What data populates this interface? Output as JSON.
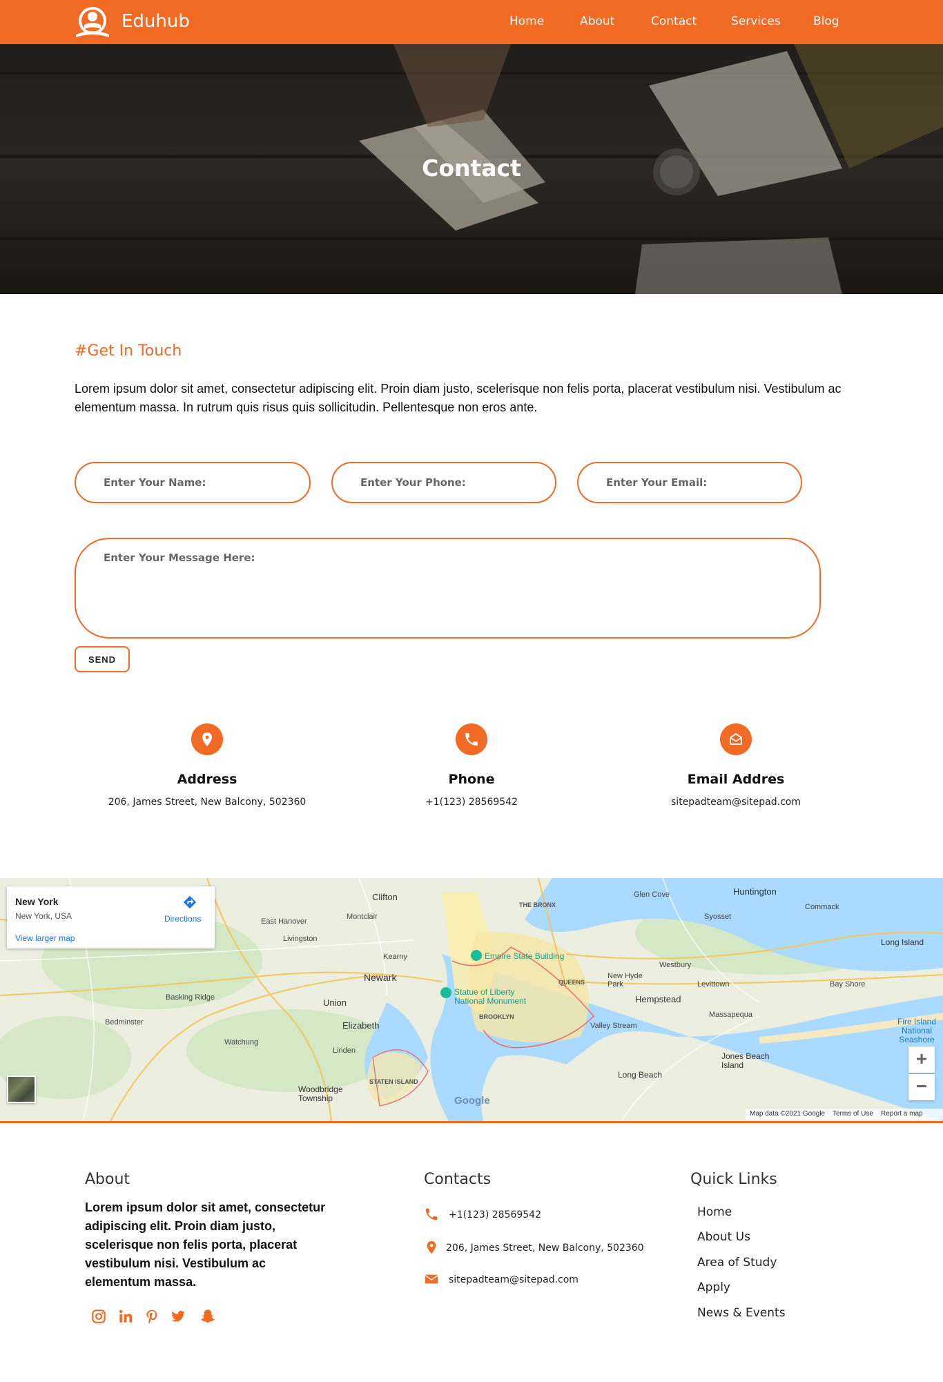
{
  "header": {
    "brand": "Eduhub",
    "nav": [
      "Home",
      "About",
      "Contact",
      "Services",
      "Blog"
    ]
  },
  "hero": {
    "title": "Contact"
  },
  "get_in_touch": {
    "tag": "#Get In Touch",
    "intro": "Lorem ipsum dolor sit amet, consectetur adipiscing elit. Proin diam justo, scelerisque non felis porta, placerat vestibulum nisi. Vestibulum ac elementum massa. In rutrum quis risus quis sollicitudin. Pellentesque non eros ante."
  },
  "form": {
    "name_placeholder": "Enter Your Name:",
    "phone_placeholder": "Enter Your Phone:",
    "email_placeholder": "Enter Your Email:",
    "message_placeholder": "Enter Your Message Here:",
    "send_label": "SEND"
  },
  "contact_info": [
    {
      "icon": "location-pin-icon",
      "title": "Address",
      "text": "206, James Street, New Balcony, 502360"
    },
    {
      "icon": "phone-icon",
      "title": "Phone",
      "text": "+1(123) 28569542"
    },
    {
      "icon": "envelope-open-icon",
      "title": "Email Addres",
      "text": "sitepadteam@sitepad.com"
    }
  ],
  "map": {
    "place_name": "New York",
    "place_sub": "New York, USA",
    "view_larger": "View larger map",
    "directions": "Directions",
    "attribution": "Map data ©2021 Google",
    "terms": "Terms of Use",
    "report": "Report a map error",
    "google": "Google",
    "labels": {
      "clifton": "Clifton",
      "newark": "Newark",
      "union": "Union",
      "elizabeth": "Elizabeth",
      "queens": "QUEENS",
      "brooklyn": "BROOKLYN",
      "the_bronx": "THE BRONX",
      "empire": "Empire State Building",
      "liberty": "Statue of Liberty National Monument",
      "hempstead": "Hempstead",
      "huntington": "Huntington",
      "long_beach": "Long Beach",
      "levittown": "Levittown",
      "glen_cove": "Glen Cove",
      "montclair": "Montclair",
      "kearny": "Kearny",
      "linden": "Linden",
      "bedminster": "Bedminster",
      "staten_island": "STATEN ISLAND",
      "jones_beach": "Jones Beach Island",
      "fire_island": "Fire Island National Seashore",
      "long_island": "Long Island",
      "massapequa": "Massapequa",
      "valley_stream": "Valley Stream",
      "woodbridge": "Woodbridge Township",
      "basking_ridge": "Basking Ridge",
      "livingston": "Livingston",
      "east_hanover": "East Hanover",
      "watchung": "Watchung",
      "new_hyde_park": "New Hyde Park",
      "westbury": "Westbury",
      "syosset": "Syosset",
      "commack": "Commack",
      "bay_shore": "Bay Shore"
    }
  },
  "footer": {
    "about_head": "About",
    "about_text": "Lorem ipsum dolor sit amet, consectetur adipiscing elit. Proin diam justo, scelerisque non felis porta, placerat vestibulum nisi. Vestibulum ac elementum massa.",
    "contacts_head": "Contacts",
    "contacts": [
      {
        "icon": "phone-icon",
        "text": "+1(123) 28569542"
      },
      {
        "icon": "location-pin-icon",
        "text": "206, James Street, New Balcony, 502360"
      },
      {
        "icon": "envelope-icon",
        "text": "sitepadteam@sitepad.com"
      }
    ],
    "quick_head": "Quick Links",
    "quick_links": [
      "Home",
      "About Us",
      "Area of Study",
      "Apply",
      "News & Events"
    ],
    "social_icons": [
      "instagram-icon",
      "linkedin-icon",
      "pinterest-icon",
      "twitter-icon",
      "snapchat-icon"
    ]
  },
  "colors": {
    "accent": "#f16b24",
    "water": "#aadaff",
    "park": "#c8e6b4",
    "land": "#eceee0"
  }
}
